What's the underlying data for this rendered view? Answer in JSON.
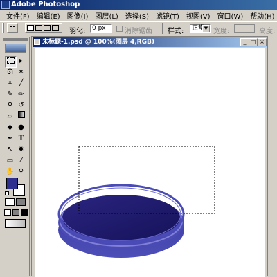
{
  "app": {
    "title": "Adobe Photoshop"
  },
  "menu": [
    "文件(F)",
    "编辑(E)",
    "图像(I)",
    "图层(L)",
    "选择(S)",
    "滤镜(T)",
    "视图(V)",
    "窗口(W)",
    "帮助(H)"
  ],
  "options": {
    "feather_label": "羽化:",
    "feather_value": "0 px",
    "antialias_label": "消除锯齿",
    "style_label": "样式:",
    "style_value": "正常",
    "width_label": "宽度:",
    "height_label": "高度:"
  },
  "document": {
    "title": "未标题-1.psd @ 100%(图层 4,RGB)"
  },
  "colors": {
    "foreground": "#2f2f8f",
    "background": "#ffffff",
    "ellipse_dark": "#1f1a6e",
    "ellipse_mid": "#3b3a9e",
    "ellipse_light": "#5c5cc0"
  },
  "icons": [
    "marquee-icon",
    "move-icon",
    "lasso-icon",
    "magic-wand-icon",
    "crop-icon",
    "slice-icon",
    "brush-icon",
    "pencil-icon",
    "clone-stamp-icon",
    "history-brush-icon",
    "eraser-icon",
    "gradient-icon",
    "blur-icon",
    "dodge-icon",
    "pen-icon",
    "type-icon",
    "path-select-icon",
    "custom-shape-icon",
    "notes-icon",
    "eyedropper-icon",
    "hand-icon",
    "zoom-icon"
  ]
}
